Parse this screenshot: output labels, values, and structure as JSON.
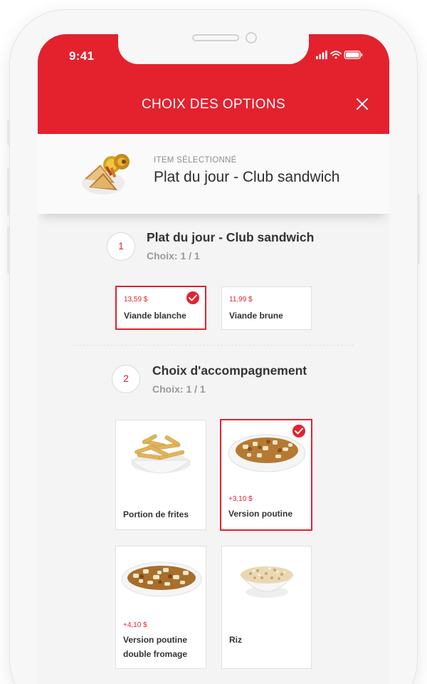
{
  "status_bar": {
    "time": "9:41"
  },
  "header": {
    "title": "CHOIX DES OPTIONS",
    "close_icon": "×"
  },
  "selected_item": {
    "kicker": "ITEM SÉLECTIONNÉ",
    "title": "Plat du jour - Club sandwich"
  },
  "sections": [
    {
      "number": "1",
      "title": "Plat du jour - Club sandwich",
      "subtitle": "Choix: 1 / 1",
      "options": [
        {
          "price": "13,59 $",
          "label": "Viande blanche",
          "selected": true
        },
        {
          "price": "11,99 $",
          "label": "Viande brune",
          "selected": false
        }
      ]
    },
    {
      "number": "2",
      "title": "Choix d'accompagnement",
      "subtitle": "Choix: 1 / 1",
      "options": [
        {
          "price": "",
          "label": "Portion de frites",
          "image_icon": "fries-bowl-icon",
          "selected": false
        },
        {
          "price": "+3,10 $",
          "label": "Version poutine",
          "image_icon": "poutine-bowl-icon",
          "selected": true
        },
        {
          "price": "+4,10 $",
          "label_line1": "Version poutine",
          "label_line2": "double fromage",
          "image_icon": "poutine-plate-icon",
          "selected": false
        },
        {
          "price": "",
          "label": "Riz",
          "image_icon": "rice-bowl-icon",
          "selected": false
        }
      ]
    }
  ],
  "colors": {
    "accent": "#e3222e",
    "text": "#333333",
    "muted": "#9a9a9a",
    "background": "#f4f4f4"
  }
}
